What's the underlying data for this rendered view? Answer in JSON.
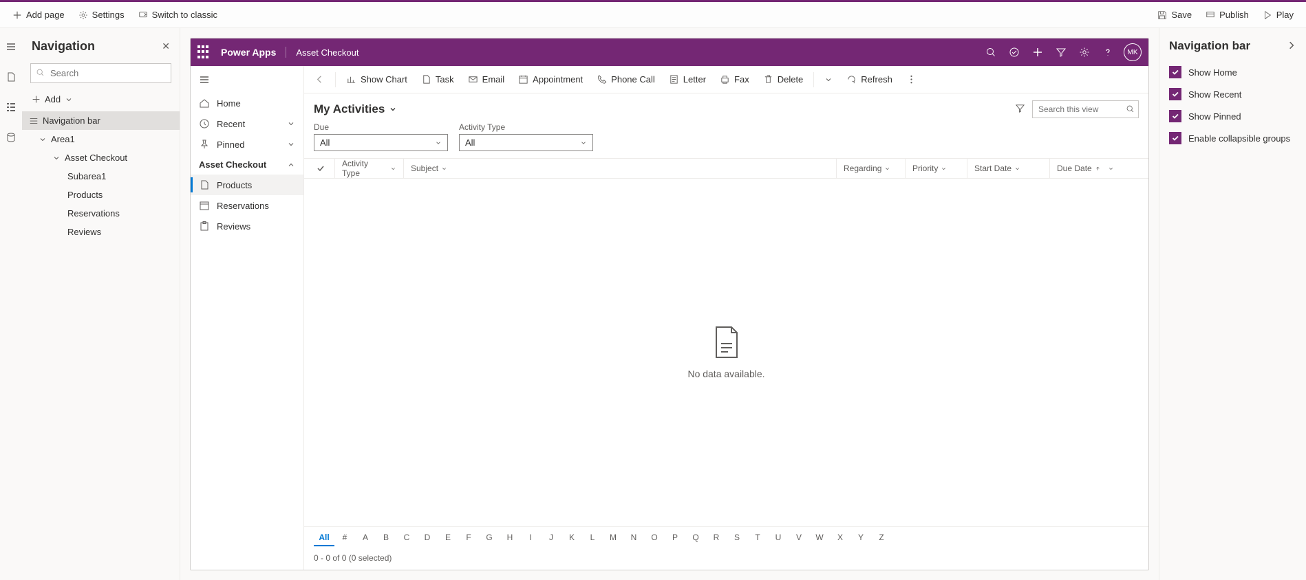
{
  "topToolbar": {
    "addPage": "Add page",
    "settings": "Settings",
    "switchClassic": "Switch to classic",
    "save": "Save",
    "publish": "Publish",
    "play": "Play"
  },
  "leftPanel": {
    "title": "Navigation",
    "searchPlaceholder": "Search",
    "addLabel": "Add",
    "tree": {
      "navBar": "Navigation bar",
      "area1": "Area1",
      "assetCheckout": "Asset Checkout",
      "subarea1": "Subarea1",
      "products": "Products",
      "reservations": "Reservations",
      "reviews": "Reviews"
    }
  },
  "appHeader": {
    "brand": "Power Apps",
    "area": "Asset Checkout",
    "avatar": "MK"
  },
  "appSidebar": {
    "home": "Home",
    "recent": "Recent",
    "pinned": "Pinned",
    "group": "Asset Checkout",
    "products": "Products",
    "reservations": "Reservations",
    "reviews": "Reviews"
  },
  "cmdBar": {
    "showChart": "Show Chart",
    "task": "Task",
    "email": "Email",
    "appointment": "Appointment",
    "phoneCall": "Phone Call",
    "letter": "Letter",
    "fax": "Fax",
    "delete": "Delete",
    "refresh": "Refresh"
  },
  "view": {
    "title": "My Activities",
    "searchPlaceholder": "Search this view",
    "filters": {
      "dueLabel": "Due",
      "dueValue": "All",
      "typeLabel": "Activity Type",
      "typeValue": "All"
    },
    "columns": {
      "activityType": "Activity Type",
      "subject": "Subject",
      "regarding": "Regarding",
      "priority": "Priority",
      "startDate": "Start Date",
      "dueDate": "Due Date"
    },
    "empty": "No data available.",
    "alphaAll": "All",
    "status": "0 - 0 of 0 (0 selected)"
  },
  "alphabet": [
    "#",
    "A",
    "B",
    "C",
    "D",
    "E",
    "F",
    "G",
    "H",
    "I",
    "J",
    "K",
    "L",
    "M",
    "N",
    "O",
    "P",
    "Q",
    "R",
    "S",
    "T",
    "U",
    "V",
    "W",
    "X",
    "Y",
    "Z"
  ],
  "rightPanel": {
    "title": "Navigation bar",
    "showHome": "Show Home",
    "showRecent": "Show Recent",
    "showPinned": "Show Pinned",
    "enableCollapsible": "Enable collapsible groups"
  }
}
